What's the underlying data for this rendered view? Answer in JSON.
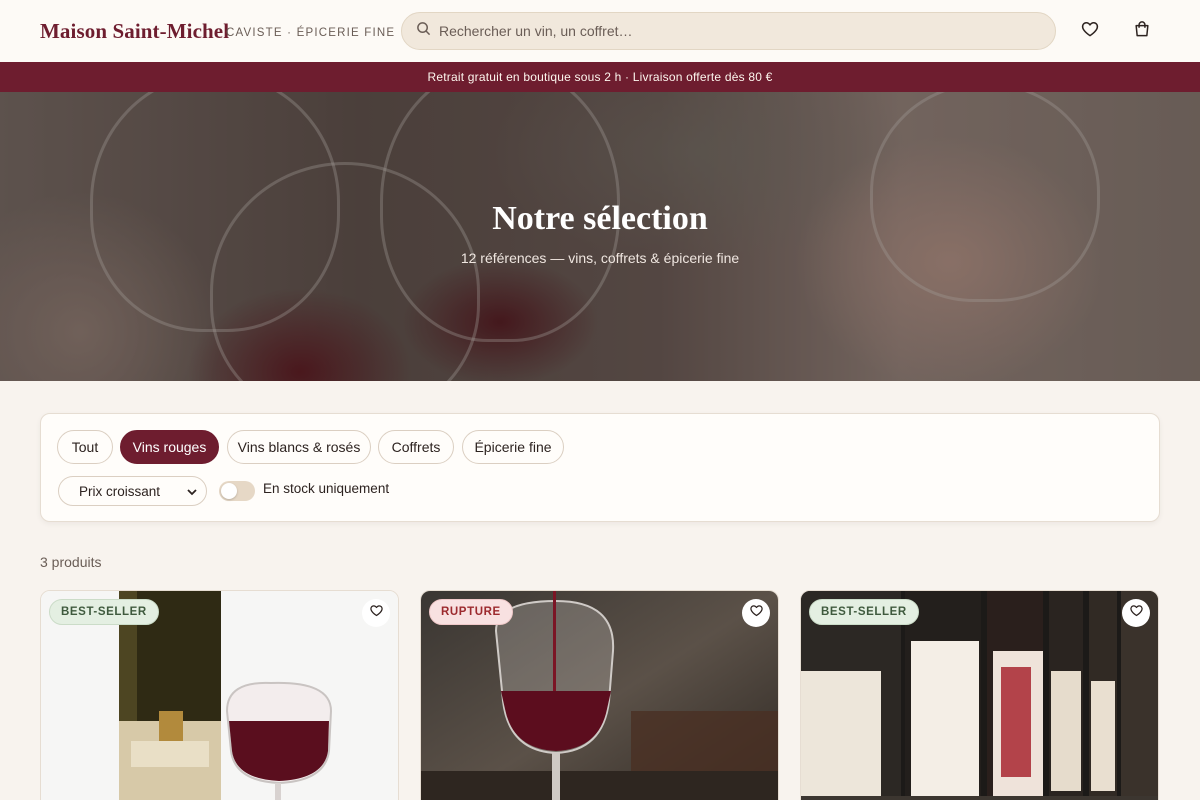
{
  "header": {
    "brand": "Maison Saint-Michel",
    "tagline": "CAVISTE · ÉPICERIE FINE",
    "search_placeholder": "Rechercher un vin, un coffret…"
  },
  "promo": "Retrait gratuit en boutique sous 2 h · Livraison offerte dès 80 €",
  "hero": {
    "title": "Notre sélection",
    "subtitle": "12 références — vins, coffrets & épicerie fine"
  },
  "filters": {
    "categories": [
      {
        "label": "Tout",
        "active": false
      },
      {
        "label": "Vins rouges",
        "active": true
      },
      {
        "label": "Vins blancs & rosés",
        "active": false
      },
      {
        "label": "Coffrets",
        "active": false
      },
      {
        "label": "Épicerie fine",
        "active": false
      }
    ],
    "sort_value": "Prix croissant",
    "in_stock_label": "En stock uniquement",
    "in_stock_on": false
  },
  "results_count": "3 produits",
  "products": [
    {
      "badge": "BEST-SELLER",
      "badge_type": "best"
    },
    {
      "badge": "RUPTURE",
      "badge_type": "rupture"
    },
    {
      "badge": "BEST-SELLER",
      "badge_type": "best"
    }
  ],
  "icons": {
    "search": "search-icon",
    "wishlist": "heart-icon",
    "cart": "shopping-bag-icon",
    "sort": "chevron-down-icon"
  },
  "colors": {
    "brand": "#6e1d2f",
    "background": "#f8f3ee",
    "search_bg": "#f1e8dc",
    "badge_best": "#e4efe2",
    "badge_rupture": "#f8e1e1"
  }
}
